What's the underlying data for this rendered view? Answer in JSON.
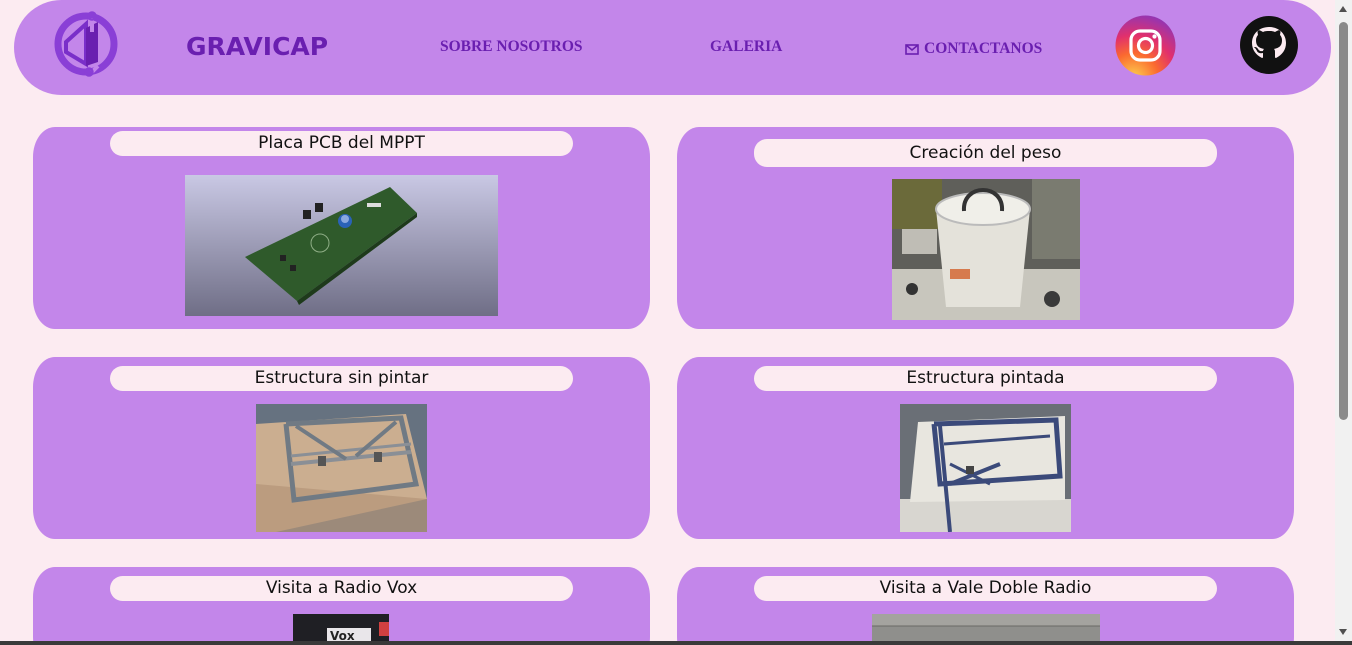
{
  "header": {
    "brand": "GRAVICAP",
    "nav": {
      "about": "SOBRE NOSOTROS",
      "gallery": "GALERIA",
      "contact": "CONTACTANOS"
    },
    "icons": [
      "logo-icon",
      "mail-icon",
      "instagram-icon",
      "github-icon"
    ]
  },
  "gallery": {
    "items": [
      {
        "title": "Placa PCB del MPPT"
      },
      {
        "title": "Creación del peso"
      },
      {
        "title": "Estructura sin pintar"
      },
      {
        "title": "Estructura pintada"
      },
      {
        "title": "Visita a Radio Vox"
      },
      {
        "title": "Visita a Vale Doble Radio"
      }
    ]
  },
  "colors": {
    "background": "#fcebf1",
    "accent": "#c386ea",
    "brand_text": "#6a1fb0"
  }
}
